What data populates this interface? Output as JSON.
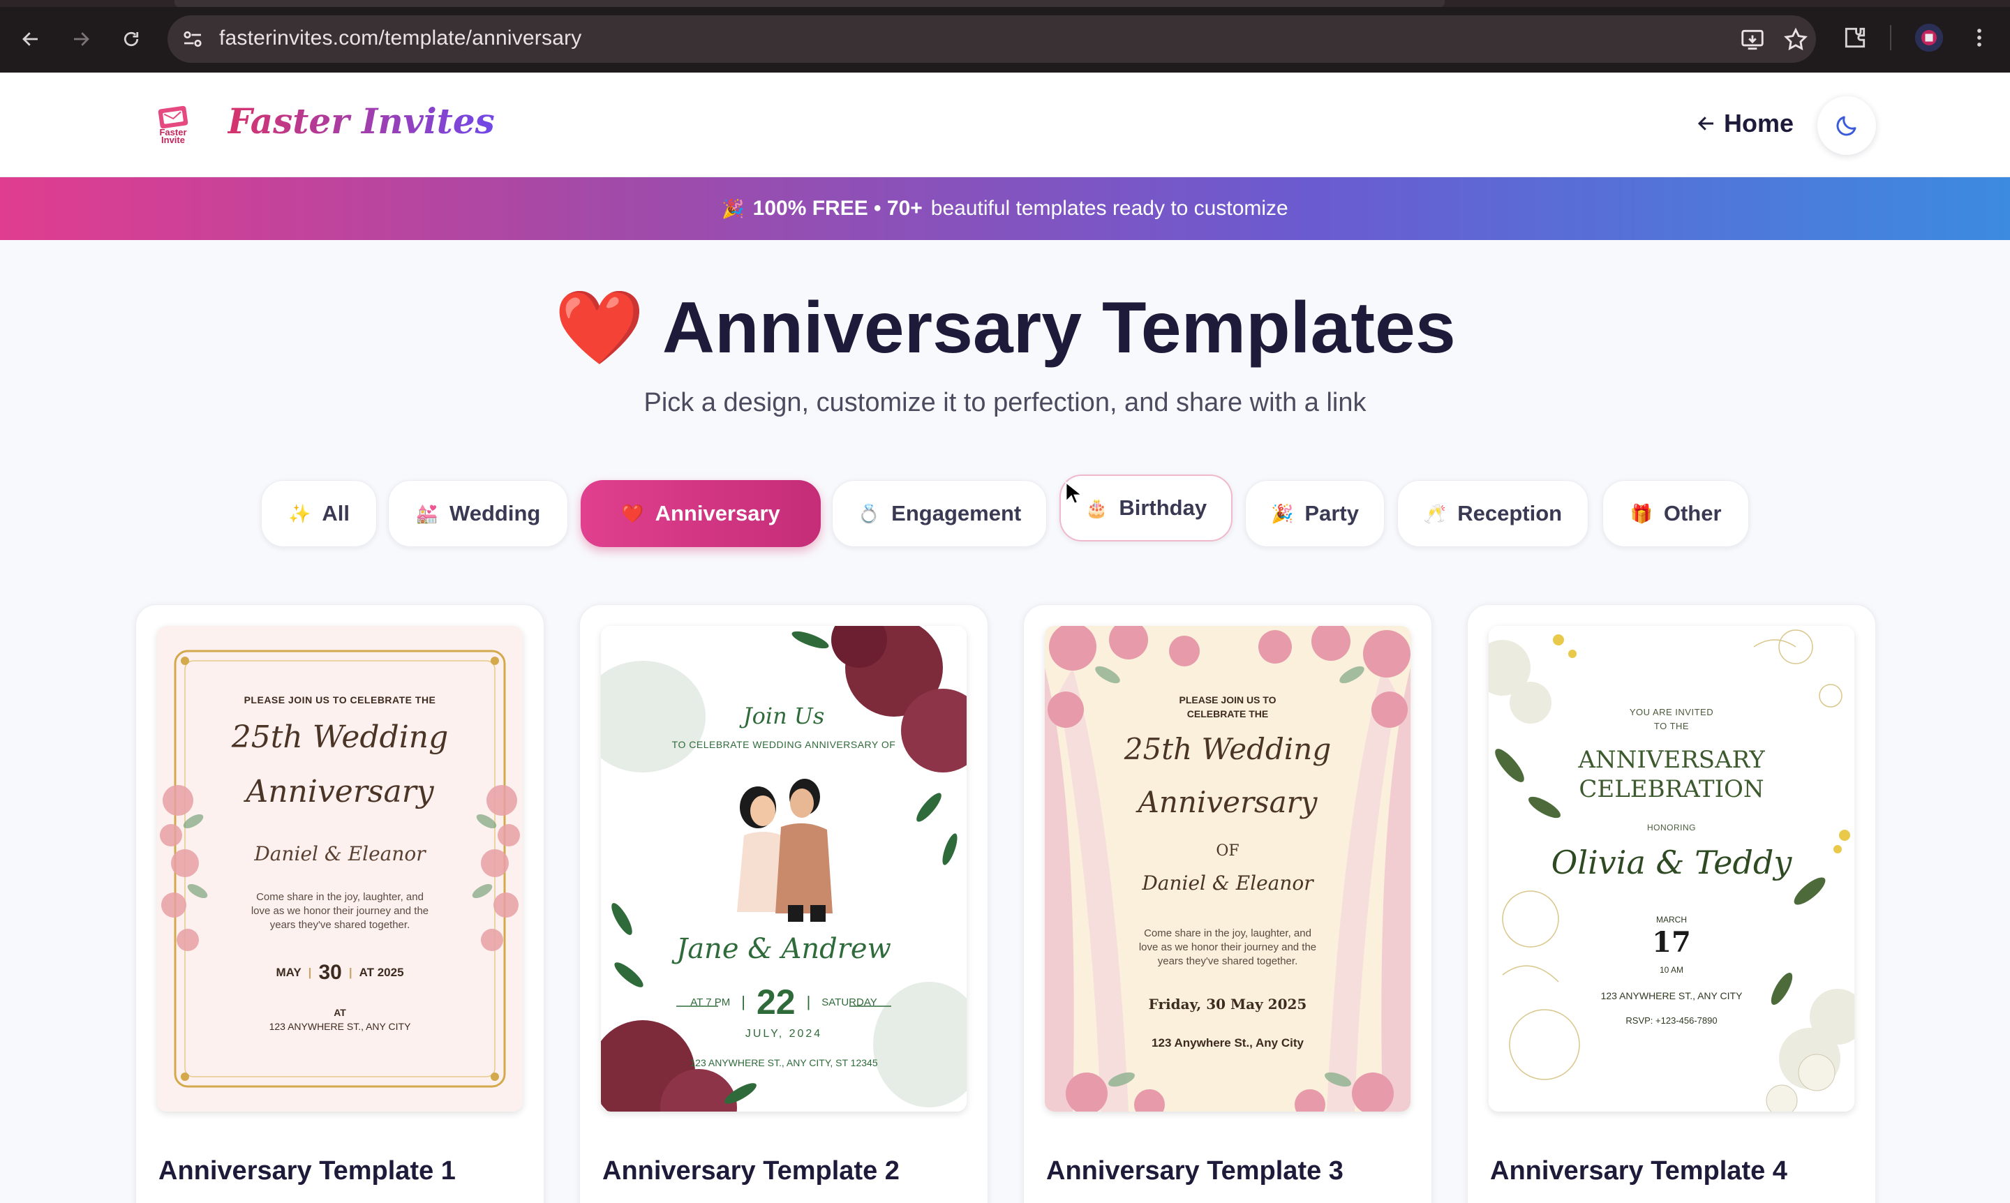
{
  "browser": {
    "url": "fasterinvites.com/template/anniversary"
  },
  "site": {
    "brand": "Faster Invites",
    "logo_small": "Faster Invite",
    "home_label": "Home",
    "theme_icon": "moon-icon"
  },
  "banner": {
    "emoji": "🎉",
    "bold": "100% FREE • 70+",
    "rest": "beautiful templates ready to customize"
  },
  "hero": {
    "emoji": "❤️",
    "title": "Anniversary Templates",
    "subtitle": "Pick a design, customize it to perfection, and share with a link"
  },
  "filters": [
    {
      "icon": "✨",
      "label": "All"
    },
    {
      "icon": "💒",
      "label": "Wedding"
    },
    {
      "icon": "❤️",
      "label": "Anniversary"
    },
    {
      "icon": "💍",
      "label": "Engagement"
    },
    {
      "icon": "🎂",
      "label": "Birthday"
    },
    {
      "icon": "🎉",
      "label": "Party"
    },
    {
      "icon": "🥂",
      "label": "Reception"
    },
    {
      "icon": "🎁",
      "label": "Other"
    }
  ],
  "templates": [
    {
      "title": "Anniversary Template 1",
      "invite": {
        "intro": "PLEASE JOIN US TO CELEBRATE THE",
        "line1": "25th Wedding",
        "line2": "Anniversary",
        "names": "Daniel & Eleanor",
        "body1": "Come share in the joy, laughter, and",
        "body2": "love as we honor their journey and the",
        "body3": "years they've shared together.",
        "month": "MAY",
        "day": "30",
        "year": "AT 2025",
        "at": "AT",
        "address": "123 ANYWHERE ST., ANY CITY"
      }
    },
    {
      "title": "Anniversary Template 2",
      "invite": {
        "join": "Join Us",
        "intro": "TO CELEBRATE WEDDING ANNIVERSARY OF",
        "names": "Jane & Andrew",
        "time": "AT 7 PM",
        "day": "22",
        "weekday": "SATURDAY",
        "month_year": "JULY, 2024",
        "address": "123 ANYWHERE ST., ANY CITY, ST 12345"
      }
    },
    {
      "title": "Anniversary Template 3",
      "invite": {
        "intro1": "PLEASE JOIN US TO",
        "intro2": "CELEBRATE THE",
        "line1": "25th Wedding",
        "line2": "Anniversary",
        "of": "OF",
        "names": "Daniel & Eleanor",
        "body1": "Come share in the joy, laughter, and",
        "body2": "love as we honor their journey and the",
        "body3": "years they've shared together.",
        "date": "Friday, 30 May 2025",
        "address": "123 Anywhere St., Any City"
      }
    },
    {
      "title": "Anniversary Template 4",
      "invite": {
        "intro1": "YOU ARE INVITED",
        "intro2": "TO THE",
        "line1": "ANNIVERSARY",
        "line2": "CELEBRATION",
        "honoring": "HONORING",
        "names": "Olivia & Teddy",
        "month": "MARCH",
        "day": "17",
        "time": "10 AM",
        "address": "123 ANYWHERE ST., ANY CITY",
        "rsvp": "RSVP: +123-456-7890"
      }
    }
  ],
  "colors": {
    "accent": "#d6336c",
    "text": "#1e1b3a",
    "muted": "#4b4a5e"
  }
}
